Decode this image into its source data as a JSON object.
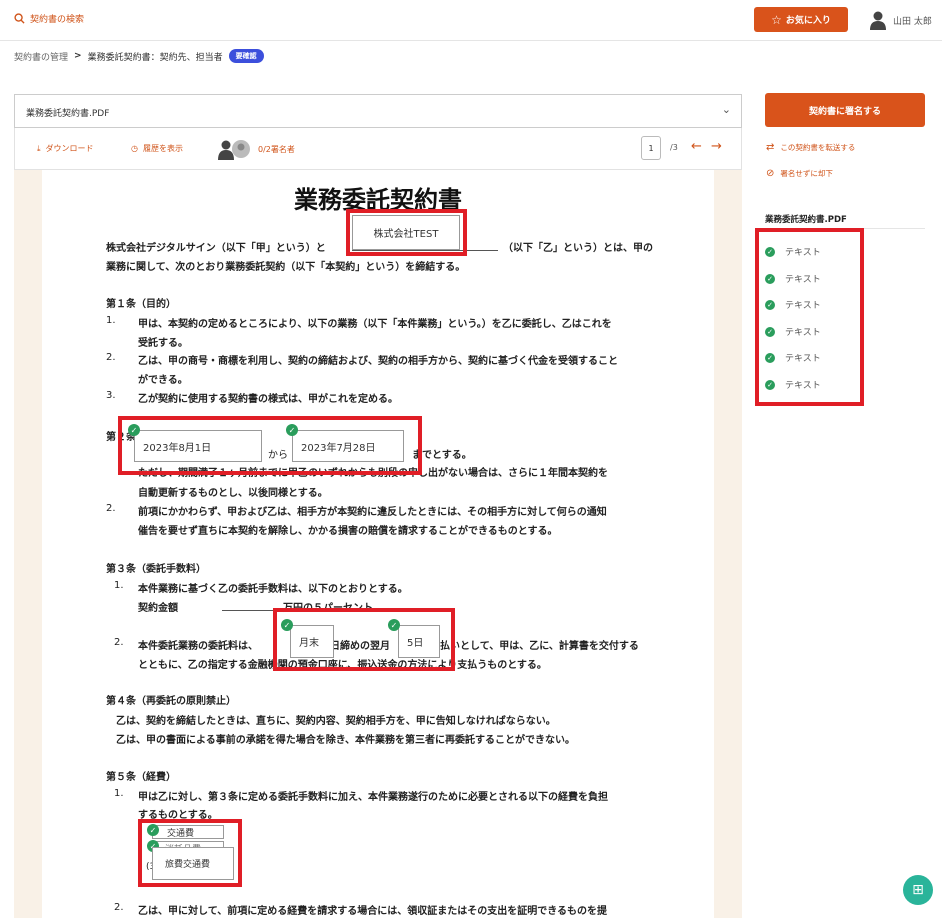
{
  "header": {
    "search_label": "契約書の検索",
    "favorite_label": "お気に入り",
    "user_name": "山田 太郎"
  },
  "breadcrumb": {
    "root": "契約書の管理",
    "separator": ">",
    "current": "業務委託契約書：契約先、担当者",
    "badge": "要確認"
  },
  "file_select": {
    "value": "業務委託契約書.PDF"
  },
  "toolbar": {
    "download": "ダウンロード",
    "history": "履歴を表示",
    "signers": "0/2署名者",
    "page_current": "1",
    "page_total": "/3"
  },
  "document": {
    "title": "業務委託契約書",
    "company_field": "株式会社TEST",
    "p1a": "株式会社デジタルサイン（以下「甲」という）と",
    "p1b": "（以下「乙」という）とは、甲の",
    "p1c": "業務に関して、次のとおり業務委託契約（以下「本契約」という）を締結する。",
    "a1": "第１条（目的）",
    "a1_1": "甲は、本契約の定めるところにより、以下の業務（以下「本件業務」という。）を乙に委託し、乙はこれを",
    "a1_1b": "受託する。",
    "a1_2": "乙は、甲の商号・商標を利用し、契約の締結および、契約の相手方から、契約に基づく代金を受領すること",
    "a1_2b": "ができる。",
    "a1_3": "乙が契約に使用する契約書の様式は、甲がこれを定める。",
    "a2": "第２条（契約期間）",
    "date_from": "2023年8月1日",
    "kara": "から",
    "date_to": "2023年7月28日",
    "a2_1end": "までとする。",
    "a2_1b": "ただし、期間満了１ヶ月前までに甲乙のいずれからも別段の申し出がない場合は、さらに１年間本契約を",
    "a2_1c": "自動更新するものとし、以後同様とする。",
    "a2_2": "前項にかかわらず、甲および乙は、相手方が本契約に違反したときには、その相手方に対して何らの通知",
    "a2_2b": "催告を要せず直ちに本契約を解除し、かかる損害の賠償を請求することができるものとする。",
    "a3": "第３条（委託手数料）",
    "a3_1": "本件業務に基づく乙の委託手数料は、以下のとおりとする。",
    "a3_1b": "契約金額",
    "a3_1c": "万円の５パーセント",
    "a3_2a": "本件委託業務の委託料は、",
    "a3_2b": "毎月",
    "field_monthend": "月末",
    "a3_2c": "日締めの翌月",
    "field_day": "5日",
    "a3_2d": "日払いとして、甲は、乙に、計算書を交付する",
    "a3_2e": "とともに、乙の指定する金融機関の預金口座に、振込送金の方法により支払うものとする。",
    "a4": "第４条（再委託の原則禁止）",
    "a4_1": "乙は、契約を締結したときは、直ちに、契約内容、契約相手方を、甲に告知しなければならない。",
    "a4_2": "乙は、甲の書面による事前の承諾を得た場合を除き、本件業務を第三者に再委託することができない。",
    "a5": "第５条（経費）",
    "a5_1": "甲は乙に対し、第３条に定める委託手数料に加え、本件業務遂行のために必要とされる以下の経費を負担",
    "a5_1b": "するものとする。",
    "exp1": "交通費",
    "exp2": "消耗品費",
    "exp3": "旅費交通費",
    "exp3_num": "(3)",
    "a5_2": "乙は、甲に対して、前項に定める経費を請求する場合には、領収証またはその支出を証明できるものを提",
    "n1": "1.",
    "n2": "2.",
    "n3": "3."
  },
  "right_panel": {
    "sign_button": "契約書に署名する",
    "forward_link": "この契約書を転送する",
    "reject_link": "署名せずに却下",
    "file_name": "業務委託契約書.PDF",
    "fields": [
      "テキスト",
      "テキスト",
      "テキスト",
      "テキスト",
      "テキスト",
      "テキスト"
    ]
  },
  "colors": {
    "accent": "#d9531b",
    "check": "#2a9d5c",
    "highlight": "#e01e26",
    "badge": "#3c4fdc"
  }
}
